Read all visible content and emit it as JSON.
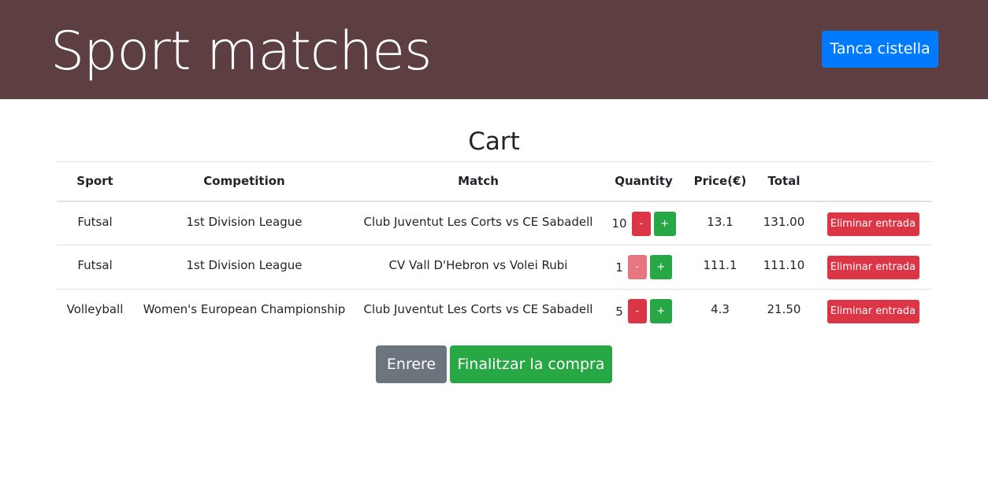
{
  "header": {
    "brand": "Sport matches",
    "close_cart_label": "Tanca cistella"
  },
  "cart": {
    "title": "Cart",
    "columns": [
      "Sport",
      "Competition",
      "Match",
      "Quantity",
      "Price(€)",
      "Total",
      ""
    ],
    "rows": [
      {
        "sport": "Futsal",
        "competition": "1st Division League",
        "match": "Club Juventut Les Corts vs CE Sabadell",
        "quantity": "10",
        "minus_label": "-",
        "plus_label": "+",
        "minus_disabled": false,
        "price": "13.1",
        "total": "131.00",
        "remove_label": "Eliminar entrada"
      },
      {
        "sport": "Futsal",
        "competition": "1st Division League",
        "match": "CV Vall D'Hebron vs Volei Rubi",
        "quantity": "1",
        "minus_label": "-",
        "plus_label": "+",
        "minus_disabled": true,
        "price": "111.1",
        "total": "111.10",
        "remove_label": "Eliminar entrada"
      },
      {
        "sport": "Volleyball",
        "competition": "Women's European Championship",
        "match": "Club Juventut Les Corts vs CE Sabadell",
        "quantity": "5",
        "minus_label": "-",
        "plus_label": "+",
        "minus_disabled": false,
        "price": "4.3",
        "total": "21.50",
        "remove_label": "Eliminar entrada"
      }
    ]
  },
  "actions": {
    "back_label": "Enrere",
    "checkout_label": "Finalitzar la compra"
  },
  "colors": {
    "header_bg": "#5d3f41",
    "primary": "#007bff",
    "success": "#28a745",
    "danger": "#dc3545",
    "secondary": "#6c757d"
  }
}
